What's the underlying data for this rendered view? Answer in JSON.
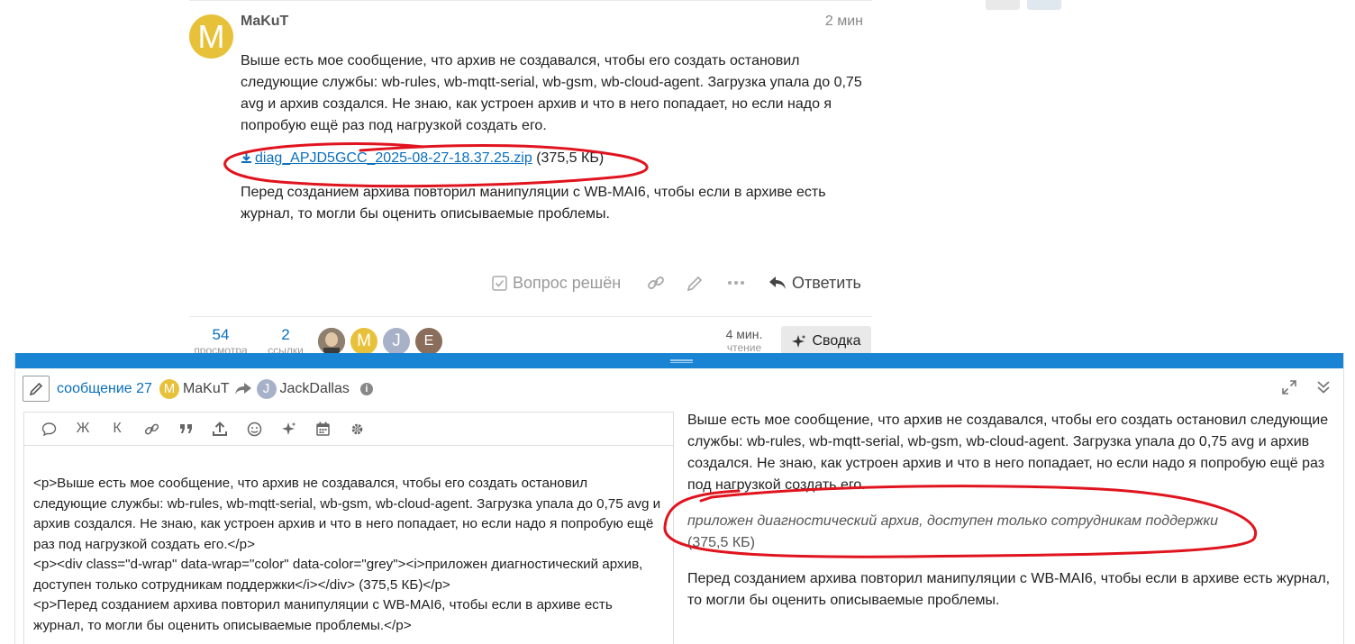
{
  "post": {
    "author": "MaKuT",
    "avatar_letter": "M",
    "age": "2 мин",
    "paragraph1": "Выше есть мое сообщение, что архив не создавался, чтобы его создать остановил следующие службы: wb-rules, wb-mqtt-serial, wb-gsm, wb-cloud-agent. Загрузка упала до 0,75 avg и архив создался. Не знаю, как устроен архив и что в него попадает, но если надо я попробую ещё раз под нагрузкой создать его.",
    "attachment_name": "diag_APJD5GCC_2025-08-27-18.37.25.zip",
    "attachment_size": "(375,5 КБ)",
    "paragraph2": "Перед созданием архива повторил манипуляции с WB-MAI6, чтобы если в архиве есть журнал, то могли бы оценить описываемые проблемы."
  },
  "actions": {
    "solved_label": "Вопрос решён",
    "reply_label": "Ответить"
  },
  "topic_map": {
    "views_count": "54",
    "views_label": "просмотра",
    "links_count": "2",
    "links_label": "ссылки",
    "participants": [
      {
        "letter": "",
        "color": "#8a6a4a",
        "kind": "photo"
      },
      {
        "letter": "M",
        "color": "#e8c13a"
      },
      {
        "letter": "J",
        "color": "#a7b1c8"
      },
      {
        "letter": "E",
        "color": "#8b6d5c"
      }
    ],
    "read_time": "4 мин.",
    "read_label": "чтение",
    "summary_label": "Сводка"
  },
  "composer": {
    "post_link": "сообщение 27",
    "author_letter": "M",
    "author_name": "MaKuT",
    "reply_to_letter": "J",
    "reply_to_name": "JackDallas",
    "info_glyph": "i",
    "toolbar": {
      "italic_label": "К",
      "bold_label": "Ж"
    },
    "editor_text": "<p>Выше есть мое сообщение, что архив не создавался, чтобы его создать остановил следующие службы: wb-rules, wb-mqtt-serial, wb-gsm, wb-cloud-agent. Загрузка упала до 0,75 avg и архив создался. Не знаю, как устроен архив и что в него попадает, но если надо я попробую ещё раз под нагрузкой создать его.</p>\n<p><div class=\"d-wrap\" data-wrap=\"color\" data-color=\"grey\"><i>приложен диагностический архив, доступен только сотрудникам поддержки</i></div> (375,5 КБ)</p>\n<p>Перед созданием архива повторил манипуляции с WB-MAI6, чтобы если в архиве есть журнал, то могли бы оценить описываемые проблемы.</p>",
    "preview": {
      "paragraph1": "Выше есть мое сообщение, что архив не создавался, чтобы его создать остановил следующие службы: wb-rules, wb-mqtt-serial, wb-gsm, wb-cloud-agent. Загрузка упала до 0,75 avg и архив создался. Не знаю, как устроен архив и что в него попадает, но если надо я попробую ещё раз под нагрузкой создать его.",
      "note_italic": "приложен диагностический архив, доступен только сотрудникам поддержки",
      "note_size": "(375,5 КБ)",
      "paragraph2": "Перед созданием архива повторил манипуляции с WB-MAI6, чтобы если в архиве есть журнал, то могли бы оценить описываемые проблемы."
    }
  },
  "colors": {
    "link": "#0a6fbd",
    "accent_bar": "#1a84d4",
    "annotation": "#e0141e"
  }
}
